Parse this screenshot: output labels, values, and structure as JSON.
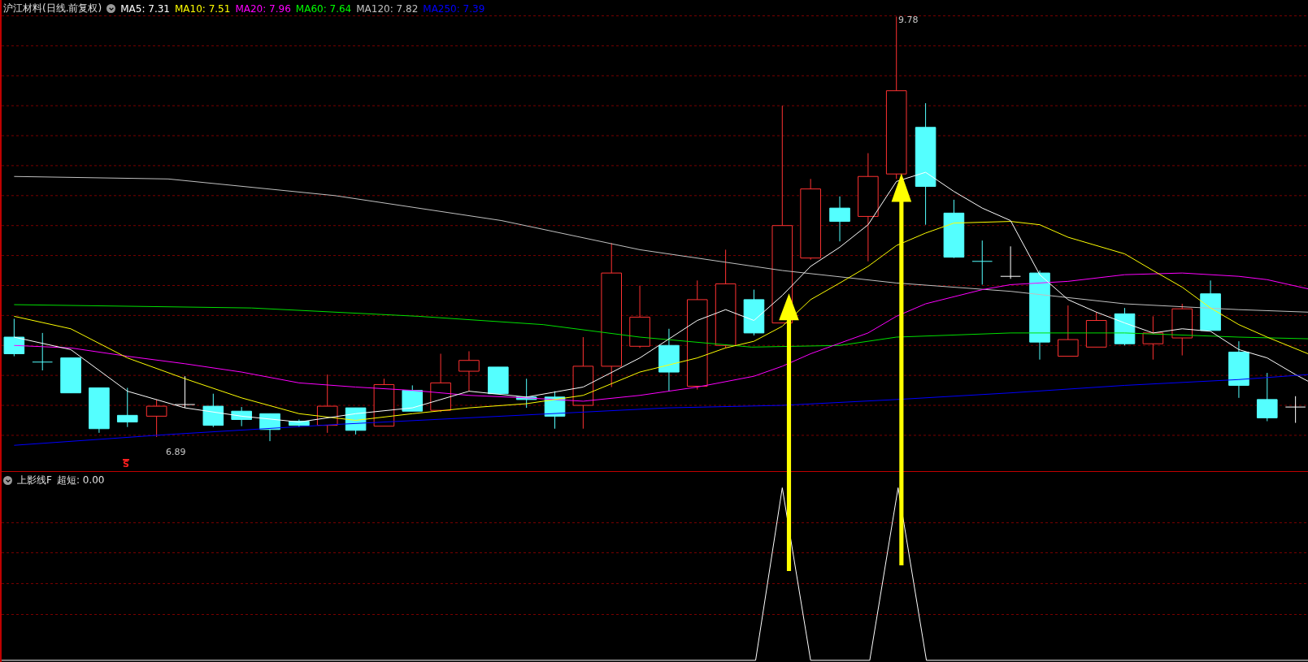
{
  "header": {
    "title": "沪江材料(日线.前复权)",
    "indicators": [
      {
        "label": "MA5: 7.31",
        "color": "#ffffff"
      },
      {
        "label": "MA10: 7.51",
        "color": "#ffff00"
      },
      {
        "label": "MA20: 7.96",
        "color": "#ff00ff"
      },
      {
        "label": "MA60: 7.64",
        "color": "#00ff00"
      },
      {
        "label": "MA120: 7.82",
        "color": "#c0c0c0"
      },
      {
        "label": "MA250: 7.39",
        "color": "#0000ff"
      }
    ]
  },
  "price_marks": {
    "high": "9.78",
    "low": "6.89"
  },
  "signal_mark": "S",
  "sub_panel": {
    "title": "上影线F",
    "reading": "超短: 0.00"
  }
}
